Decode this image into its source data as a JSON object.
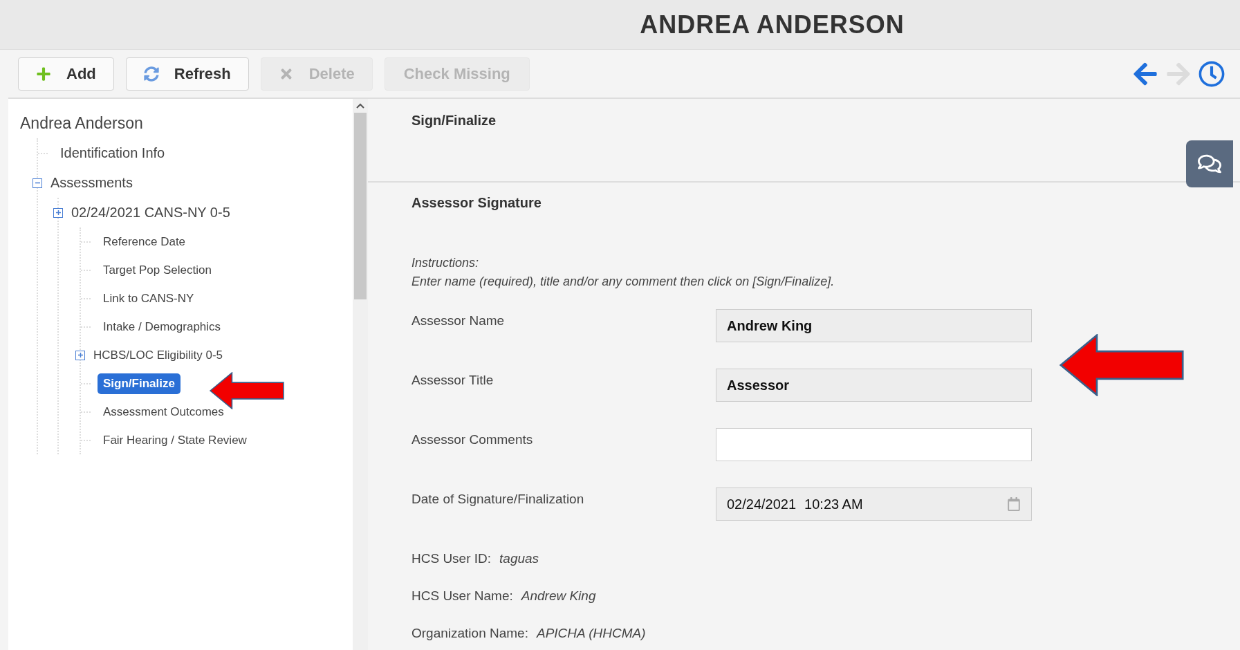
{
  "header": {
    "title": "ANDREA ANDERSON"
  },
  "toolbar": {
    "buttons": [
      {
        "kind": "add",
        "label": "Add",
        "disabled": false
      },
      {
        "kind": "refresh",
        "label": "Refresh",
        "disabled": false
      },
      {
        "kind": "delete",
        "label": "Delete",
        "disabled": true
      },
      {
        "kind": "plain",
        "label": "Check Missing",
        "disabled": true
      }
    ],
    "nav": [
      {
        "kind": "back",
        "disabled": false
      },
      {
        "kind": "forward",
        "disabled": true
      },
      {
        "kind": "history",
        "disabled": false
      }
    ]
  },
  "tree": {
    "root": "Andrea Anderson",
    "items": [
      {
        "label": "Identification Info",
        "selected": false
      },
      {
        "label": "Assessments",
        "selected": false,
        "expanded": true,
        "children": [
          {
            "label": "02/24/2021 CANS-NY 0-5",
            "selected": false,
            "expanded": false,
            "children": [
              {
                "label": "Reference Date",
                "selected": false
              },
              {
                "label": "Target Pop Selection",
                "selected": false
              },
              {
                "label": "Link to CANS-NY",
                "selected": false
              },
              {
                "label": "Intake / Demographics",
                "selected": false
              },
              {
                "label": "HCBS/LOC Eligibility 0-5",
                "selected": false,
                "expanded": false
              },
              {
                "label": "Sign/Finalize",
                "selected": true
              },
              {
                "label": "Assessment Outcomes",
                "selected": false
              },
              {
                "label": "Fair Hearing / State Review",
                "selected": false
              }
            ]
          }
        ]
      }
    ]
  },
  "content": {
    "section_title": "Sign/Finalize",
    "subsection_title": "Assessor Signature",
    "instructions": [
      "Instructions:",
      "Enter name (required), title and/or any comment then click on [Sign/Finalize]."
    ],
    "fields": [
      {
        "kind": "text",
        "label": "Assessor Name",
        "value": "Andrew King",
        "readonly": true
      },
      {
        "kind": "text",
        "label": "Assessor Title",
        "value": "Assessor",
        "readonly": true
      },
      {
        "kind": "text",
        "label": "Assessor Comments",
        "readonly": false
      },
      {
        "kind": "datetime",
        "label": "Date of Signature/Finalization",
        "date": "02/24/2021",
        "time": "10:23 AM",
        "readonly": true
      }
    ],
    "info": [
      {
        "label": "HCS User ID:",
        "value": "taguas"
      },
      {
        "label": "HCS User Name:",
        "value": "Andrew King"
      },
      {
        "label": "Organization Name:",
        "value": "APICHA (HHCMA)"
      }
    ]
  }
}
